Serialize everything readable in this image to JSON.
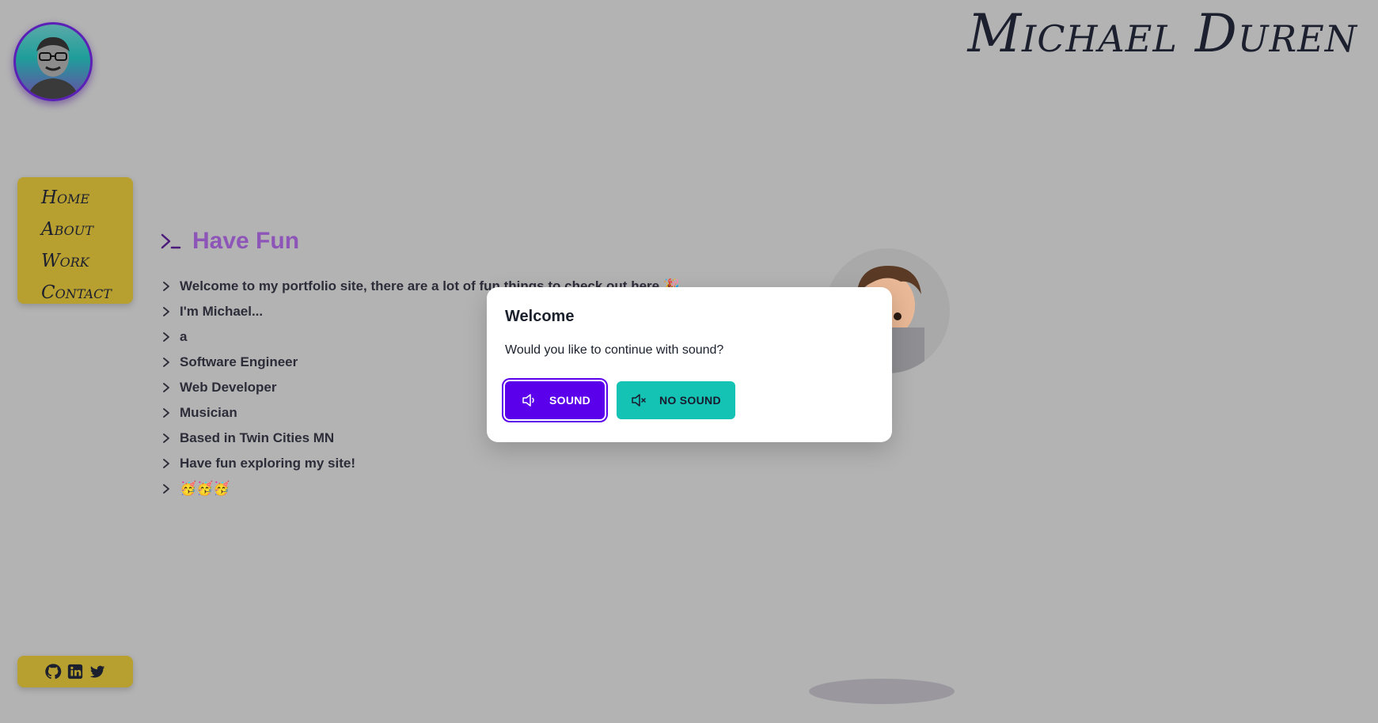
{
  "header": {
    "site_name": "Michael Duren"
  },
  "nav": {
    "items": [
      {
        "label": "Home"
      },
      {
        "label": "About"
      },
      {
        "label": "Work"
      },
      {
        "label": "Contact"
      }
    ]
  },
  "social": {
    "icons": [
      "github-icon",
      "linkedin-icon",
      "twitter-icon"
    ]
  },
  "main": {
    "heading": "Have Fun",
    "lines": [
      "Welcome to my portfolio site, there are a lot of fun things to check out here 🎉",
      "I'm Michael...",
      "a",
      "Software Engineer",
      "Web Developer",
      "Musician",
      "Based in Twin Cities MN",
      "Have fun exploring my site!",
      "🥳🥳🥳"
    ]
  },
  "modal": {
    "title": "Welcome",
    "text": "Would you like to continue with sound?",
    "sound_label": "SOUND",
    "no_sound_label": "NO SOUND"
  },
  "colors": {
    "background": "#b3b3b3",
    "nav_bg": "#b8a030",
    "heading": "#8e55b8",
    "sound_button": "#5b00ea",
    "no_sound_button": "#14c3b3"
  }
}
